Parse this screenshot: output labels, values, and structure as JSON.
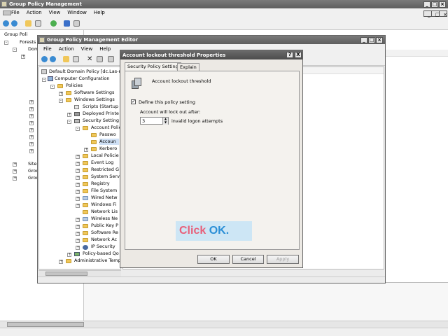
{
  "main_window": {
    "title": "Group Policy Management",
    "menu": [
      "File",
      "Action",
      "View",
      "Window",
      "Help"
    ],
    "tree": [
      "Group Poli",
      "Forests",
      "Dom",
      "Site",
      "Grou",
      "Grou"
    ]
  },
  "editor_window": {
    "title": "Group Policy Management Editor",
    "menu": [
      "File",
      "Action",
      "View",
      "Help"
    ],
    "tree": {
      "root": "Default Domain Policy [dc.Las-n",
      "computer_config": "Computer Configuration",
      "policies": "Policies",
      "software_settings": "Software Settings",
      "windows_settings": "Windows Settings",
      "scripts": "Scripts (Startup",
      "deployed_printers": "Deployed Printe",
      "security_settings": "Security Setting",
      "account_policies": "Account Polic",
      "password": "Passwo",
      "account_lockout": "Accoun",
      "kerberos": "Kerbero",
      "local_policies": "Local Policie",
      "event_log": "Event Log",
      "restricted_groups": "Restricted G",
      "system_services": "System Serv",
      "registry": "Registry",
      "file_system": "File System",
      "wired_network": "Wired Netw",
      "windows_firewall": "Windows Fi",
      "network_list": "Network Lis",
      "wireless_network": "Wireless Ne",
      "public_key": "Public Key P",
      "software_restriction": "Software Re",
      "network_access": "Network Ac",
      "ip_security": "IP Security",
      "policy_based_qos": "Policy-based Qo",
      "admin_templates": "Administrative Temp"
    }
  },
  "dialog": {
    "title": "Account lockout threshold Properties",
    "help_button": "?",
    "close_button": "X",
    "tabs": [
      "Security Policy Setting",
      "Explain"
    ],
    "policy_name": "Account lockout threshold",
    "define_checkbox_label": "Define this policy setting",
    "define_checked": true,
    "lockout_label": "Account will lock out after:",
    "spinner_value": "3",
    "spinner_suffix": "invalid logon attempts",
    "buttons": {
      "ok": "OK",
      "cancel": "Cancel",
      "apply": "Apply"
    }
  },
  "annotation": {
    "prefix": "Click ",
    "target": "OK",
    "suffix": "."
  },
  "colors": {
    "annotation_bg": "#cde6f5",
    "annotation_prefix": "#e8607a",
    "annotation_target": "#2b8fd6",
    "selection": "#cfe0f5"
  }
}
